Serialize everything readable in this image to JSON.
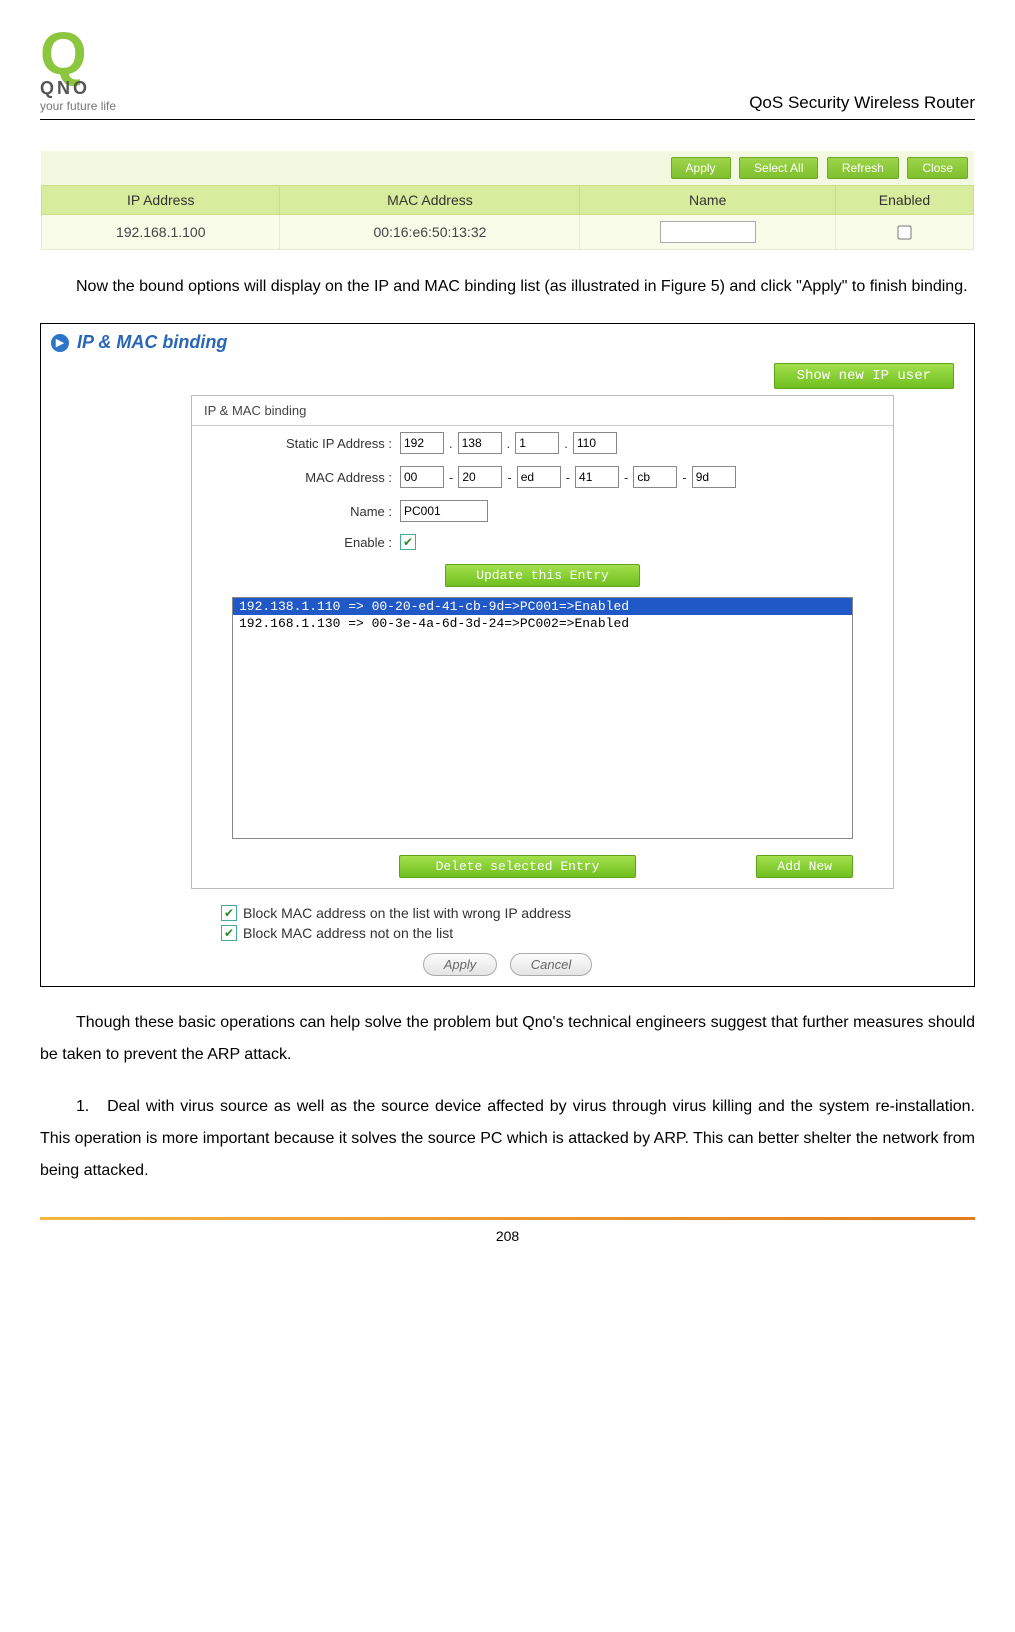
{
  "header": {
    "logo_brand": "QNO",
    "logo_tag": "your future life",
    "title": "QoS Security Wireless Router"
  },
  "fig1": {
    "buttons": {
      "apply": "Apply",
      "select_all": "Select All",
      "refresh": "Refresh",
      "close": "Close"
    },
    "cols": {
      "ip": "IP Address",
      "mac": "MAC Address",
      "name": "Name",
      "enabled": "Enabled"
    },
    "row": {
      "ip": "192.168.1.100",
      "mac": "00:16:e6:50:13:32",
      "name": "",
      "enabled": false
    }
  },
  "para1": "Now the bound options will display on the IP and MAC binding list (as illustrated in Figure 5) and click \"Apply\" to finish binding.",
  "fig2": {
    "section_title": "IP & MAC binding",
    "show_new": "Show new IP user",
    "panel_title": "IP & MAC binding",
    "labels": {
      "static_ip": "Static IP Address :",
      "mac": "MAC Address :",
      "name": "Name :",
      "enable": "Enable :"
    },
    "ip": [
      "192",
      "138",
      "1",
      "110"
    ],
    "mac": [
      "00",
      "20",
      "ed",
      "41",
      "cb",
      "9d"
    ],
    "name_val": "PC001",
    "enable_checked": true,
    "update_btn": "Update this Entry",
    "list": [
      "192.138.1.110 => 00-20-ed-41-cb-9d=>PC001=>Enabled",
      "192.168.1.130 => 00-3e-4a-6d-3d-24=>PC002=>Enabled"
    ],
    "list_selected_index": 0,
    "delete_btn": "Delete selected Entry",
    "add_btn": "Add New",
    "opt1": "Block MAC address on the list with wrong IP address",
    "opt2": "Block MAC address not on the list",
    "apply": "Apply",
    "cancel": "Cancel"
  },
  "para2": "Though these basic operations can help solve the problem but Qno's technical engineers suggest that further measures should be taken to prevent the ARP attack.",
  "para3_num": "1.",
  "para3": "Deal with virus source as well as the source device affected by virus through virus killing and the system re-installation. This operation is more important because it solves the source PC which is attacked by ARP. This can better shelter the network from being attacked.",
  "page_number": "208"
}
